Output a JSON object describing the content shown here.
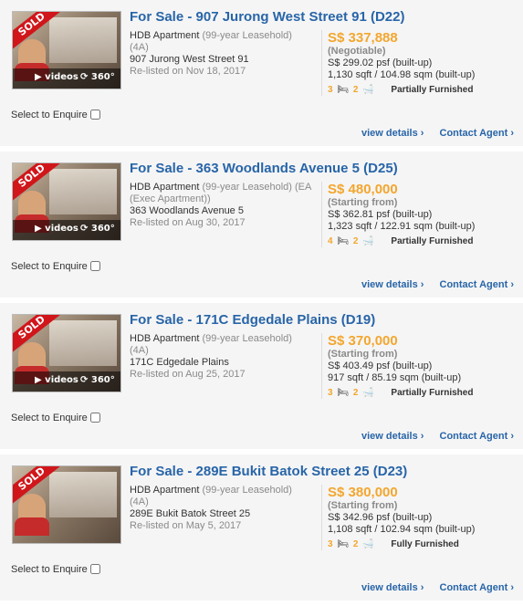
{
  "listings": [
    {
      "ribbon": "SOLD",
      "media": {
        "videos_label": "videos",
        "vr_label": "360°"
      },
      "title": "For Sale - 907 Jurong West Street 91 (D22)",
      "type_main": "HDB Apartment",
      "tenure": "(99-year Leasehold)",
      "type_sub": "(4A)",
      "address": "907 Jurong West Street 91",
      "relisted": "Re-listed on Nov 18, 2017",
      "price": "S$ 337,888",
      "price_qualifier": "(Negotiable)",
      "psf": "S$ 299.02 psf (built-up)",
      "size": "1,130 sqft / 104.98 sqm (built-up)",
      "beds": "3",
      "baths": "2",
      "furnishing": "Partially Furnished",
      "enquire_label": "Select to Enquire",
      "view_details": "view details ›",
      "contact_agent": "Contact Agent ›"
    },
    {
      "ribbon": "SOLD",
      "media": {
        "videos_label": "videos",
        "vr_label": "360°"
      },
      "title": "For Sale - 363 Woodlands Avenue 5 (D25)",
      "type_main": "HDB Apartment",
      "tenure": "(99-year Leasehold) (EA (Exec Apartment))",
      "type_sub": "",
      "address": "363 Woodlands Avenue 5",
      "relisted": "Re-listed on Aug 30, 2017",
      "price": "S$ 480,000",
      "price_qualifier": "(Starting from)",
      "psf": "S$ 362.81 psf (built-up)",
      "size": "1,323 sqft / 122.91 sqm (built-up)",
      "beds": "4",
      "baths": "2",
      "furnishing": "Partially Furnished",
      "enquire_label": "Select to Enquire",
      "view_details": "view details ›",
      "contact_agent": "Contact Agent ›"
    },
    {
      "ribbon": "SOLD",
      "media": {
        "videos_label": "videos",
        "vr_label": "360°"
      },
      "title": "For Sale - 171C Edgedale Plains (D19)",
      "type_main": "HDB Apartment",
      "tenure": "(99-year Leasehold)",
      "type_sub": "(4A)",
      "address": "171C Edgedale Plains",
      "relisted": "Re-listed on Aug 25, 2017",
      "price": "S$ 370,000",
      "price_qualifier": "(Starting from)",
      "psf": "S$ 403.49 psf (built-up)",
      "size": "917 sqft / 85.19 sqm (built-up)",
      "beds": "3",
      "baths": "2",
      "furnishing": "Partially Furnished",
      "enquire_label": "Select to Enquire",
      "view_details": "view details ›",
      "contact_agent": "Contact Agent ›"
    },
    {
      "ribbon": "SOLD",
      "media": null,
      "title": "For Sale - 289E Bukit Batok Street 25 (D23)",
      "type_main": "HDB Apartment",
      "tenure": "(99-year Leasehold)",
      "type_sub": "(4A)",
      "address": "289E Bukit Batok Street 25",
      "relisted": "Re-listed on May 5, 2017",
      "price": "S$ 380,000",
      "price_qualifier": "(Starting from)",
      "psf": "S$ 342.96 psf (built-up)",
      "size": "1,108 sqft / 102.94 sqm (built-up)",
      "beds": "3",
      "baths": "2",
      "furnishing": "Fully Furnished",
      "enquire_label": "Select to Enquire",
      "view_details": "view details ›",
      "contact_agent": "Contact Agent ›"
    }
  ],
  "colors": {
    "title": "#2865a8",
    "price": "#f3a62e",
    "sold_ribbon": "#d0161b"
  },
  "icons": {
    "bed": "bed-icon",
    "bath": "bath-icon",
    "sofa": "sofa-icon",
    "video": "video-icon",
    "vr": "360-icon"
  }
}
